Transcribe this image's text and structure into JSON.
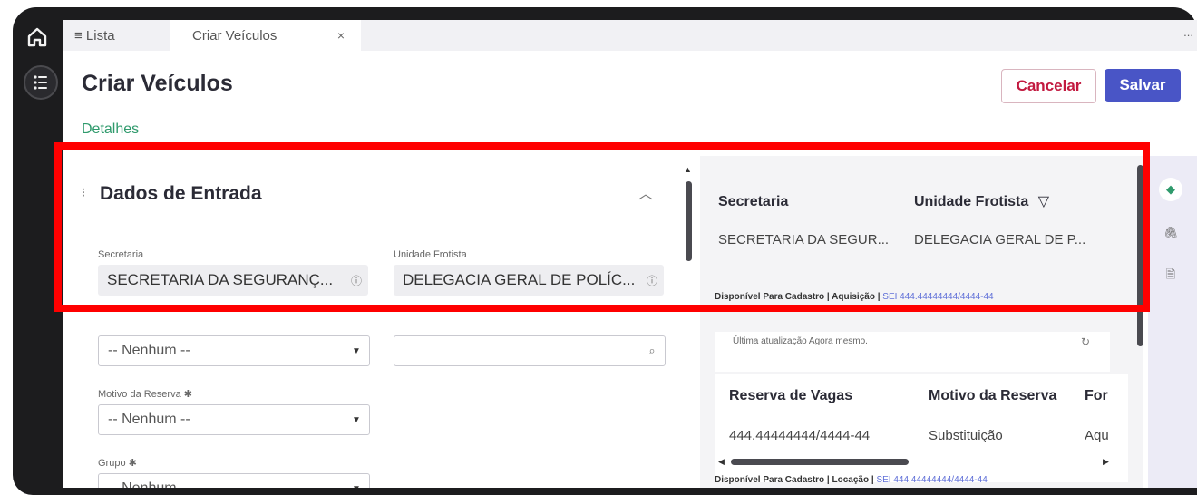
{
  "tabs": {
    "list_label": "≡ Lista",
    "active_label": "Criar Veículos",
    "close_glyph": "×",
    "overflow_glyph": "..."
  },
  "header": {
    "title": "Criar Veículos",
    "cancel_label": "Cancelar",
    "save_label": "Salvar"
  },
  "section_link": "Detalhes",
  "form": {
    "title": "Dados de Entrada",
    "secretaria": {
      "label": "Secretaria",
      "value": "SECRETARIA DA SEGURANÇ..."
    },
    "unidade": {
      "label": "Unidade Frotista",
      "value": "DELEGACIA GERAL DE POLÍC..."
    },
    "select_placeholder": "-- Nenhum --",
    "motivo_label": "Motivo da Reserva ✱",
    "grupo_label": "Grupo ✱"
  },
  "right_panel": {
    "table1": {
      "headers": [
        "Secretaria",
        "Unidade Frotista"
      ],
      "row": [
        "SECRETARIA DA SEGUR...",
        "DELEGACIA GERAL DE P..."
      ]
    },
    "source1": {
      "prefix": "Disponível Para Cadastro | Aquisição |",
      "link": "SEI 444.44444444/4444-44"
    },
    "update_text": "Última atualização Agora mesmo.",
    "table2": {
      "headers": [
        "Reserva de Vagas",
        "Motivo da Reserva",
        "For"
      ],
      "row": [
        "444.44444444/4444-44",
        "Substituição",
        "Aqu"
      ]
    },
    "source2": {
      "prefix": "Disponível Para Cadastro | Locação |",
      "link": "SEI 444.44444444/4444-44"
    }
  },
  "colors": {
    "accent": "#4955c6",
    "cancel": "#c2193f",
    "link_green": "#2f9a6c",
    "highlight": "#ff0000"
  }
}
